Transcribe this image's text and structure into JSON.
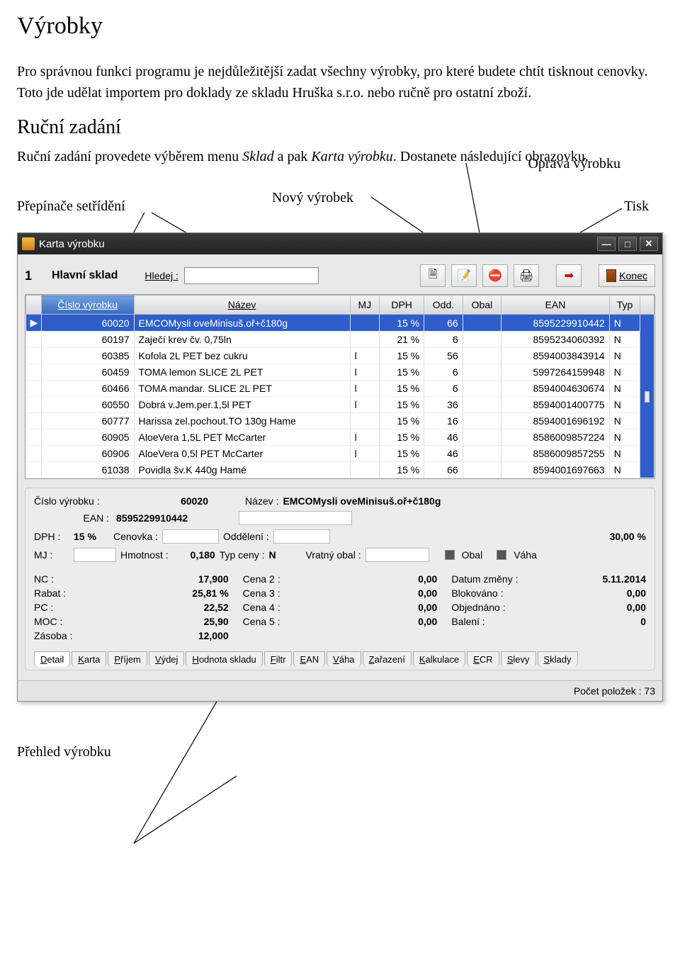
{
  "doc": {
    "heading": "Výrobky",
    "para1a": "Pro správnou funkci programu je nejdůležitější zadat všechny výrobky, pro které budete chtít tisknout cenovky. Toto jde udělat importem pro doklady ze skladu Hruška s.r.o. nebo ručně pro ostatní zboží.",
    "subheading": "Ruční zadání",
    "para2a": "Ruční zadání provedete výběrem menu ",
    "para2b": "Sklad",
    "para2c": " a pak ",
    "para2d": "Karta výrobku",
    "para2e": ". Dostanete následující obrazovku.",
    "annot_oprava": "Oprava výrobku",
    "annot_novy": "Nový výrobek",
    "annot_prep": "Přepínače setřídění",
    "annot_tisk": "Tisk",
    "annot_prehled": "Přehled výrobku"
  },
  "window": {
    "title": "Karta výrobku",
    "sklad_no": "1",
    "sklad_name": "Hlavní sklad",
    "hledej_label": "Hledej :",
    "konec_label": "Konec",
    "headers": {
      "cislo": "Číslo výrobku",
      "nazev": "Název",
      "mj": "MJ",
      "dph": "DPH",
      "odd": "Odd.",
      "obal": "Obal",
      "ean": "EAN",
      "typ": "Typ"
    },
    "rows": [
      {
        "cislo": "60020",
        "nazev": "EMCOMysli oveMinisuš.oř+č180g",
        "mj": "",
        "dph": "15 %",
        "odd": "66",
        "obal": "",
        "ean": "8595229910442",
        "typ": "N"
      },
      {
        "cislo": "60197",
        "nazev": "Zaječí krev čv. 0,75ln",
        "mj": "",
        "dph": "21 %",
        "odd": "6",
        "obal": "",
        "ean": "8595234060392",
        "typ": "N"
      },
      {
        "cislo": "60385",
        "nazev": "Kofola 2L PET bez cukru",
        "mj": "l",
        "dph": "15 %",
        "odd": "56",
        "obal": "",
        "ean": "8594003843914",
        "typ": "N"
      },
      {
        "cislo": "60459",
        "nazev": "TOMA lemon SLICE 2L PET",
        "mj": "l",
        "dph": "15 %",
        "odd": "6",
        "obal": "",
        "ean": "5997264159948",
        "typ": "N"
      },
      {
        "cislo": "60466",
        "nazev": "TOMA mandar.  SLICE 2L PET",
        "mj": "l",
        "dph": "15 %",
        "odd": "6",
        "obal": "",
        "ean": "8594004630674",
        "typ": "N"
      },
      {
        "cislo": "60550",
        "nazev": "Dobrá v.Jem.per.1,5l  PET",
        "mj": "l",
        "dph": "15 %",
        "odd": "36",
        "obal": "",
        "ean": "8594001400775",
        "typ": "N"
      },
      {
        "cislo": "60777",
        "nazev": "Harissa zel.pochout.TO 130g Hame",
        "mj": "",
        "dph": "15 %",
        "odd": "16",
        "obal": "",
        "ean": "8594001696192",
        "typ": "N"
      },
      {
        "cislo": "60905",
        "nazev": "AloeVera 1,5L PET  McCarter",
        "mj": "l",
        "dph": "15 %",
        "odd": "46",
        "obal": "",
        "ean": "8586009857224",
        "typ": "N"
      },
      {
        "cislo": "60906",
        "nazev": "AloeVera 0,5l PET McCarter",
        "mj": "l",
        "dph": "15 %",
        "odd": "46",
        "obal": "",
        "ean": "8586009857255",
        "typ": "N"
      },
      {
        "cislo": "61038",
        "nazev": "Povidla šv.K 440g Hamé",
        "mj": "",
        "dph": "15 %",
        "odd": "66",
        "obal": "",
        "ean": "8594001697663",
        "typ": "N"
      }
    ],
    "lab_cislo": "Číslo výrobku :",
    "lab_nazev": "Název :",
    "lab_ean": "EAN :",
    "lab_dph": "DPH :",
    "lab_cenovka": "Cenovka :",
    "lab_oddeleni": "Oddělení :",
    "lab_pct": "30,00 %",
    "lab_mj": "MJ :",
    "lab_hmotnost": "Hmotnost :",
    "lab_typceny": "Typ ceny :",
    "lab_vratny": "Vratný obal :",
    "lab_obal": "Obal",
    "lab_vaha": "Váha",
    "val_cislo": "60020",
    "val_nazev": "EMCOMysli oveMinisuš.oř+č180g",
    "val_ean": "8595229910442",
    "val_dph": "15 %",
    "val_hmotnost": "0,180",
    "val_typceny": "N",
    "price_left": [
      {
        "label": "NC :",
        "value": "17,900"
      },
      {
        "label": "Rabat :",
        "value": "25,81 %"
      },
      {
        "label": "PC :",
        "value": "22,52"
      },
      {
        "label": "MOC :",
        "value": "25,90"
      },
      {
        "label": "Zásoba :",
        "value": "12,000"
      }
    ],
    "price_mid": [
      {
        "label": "Cena 2 :",
        "value": "0,00"
      },
      {
        "label": "Cena 3 :",
        "value": "0,00"
      },
      {
        "label": "Cena 4 :",
        "value": "0,00"
      },
      {
        "label": "Cena 5 :",
        "value": "0,00"
      }
    ],
    "price_right": [
      {
        "label": "Datum změny :",
        "value": "5.11.2014"
      },
      {
        "label": "Blokováno :",
        "value": "0,00"
      },
      {
        "label": "Objednáno :",
        "value": "0,00"
      },
      {
        "label": "Balení :",
        "value": "0"
      }
    ],
    "tabs": [
      "Detail",
      "Karta",
      "Příjem",
      "Výdej",
      "Hodnota skladu",
      "Filtr",
      "EAN",
      "Váha",
      "Zařazení",
      "Kalkulace",
      "ECR",
      "Slevy",
      "Sklady"
    ],
    "status": "Počet položek : 73"
  }
}
